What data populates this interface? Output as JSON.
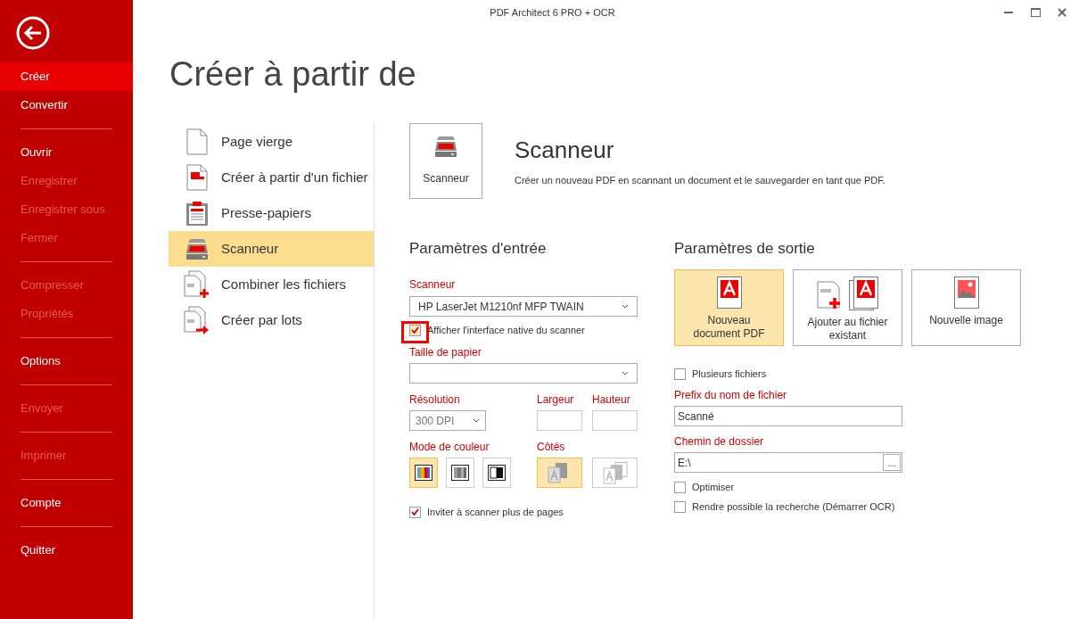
{
  "window": {
    "title": "PDF Architect 6 PRO + OCR"
  },
  "sidebar": {
    "groups": [
      [
        {
          "label": "Créer",
          "selected": true,
          "disabled": false
        },
        {
          "label": "Convertir",
          "selected": false,
          "disabled": false
        }
      ],
      [
        {
          "label": "Ouvrir",
          "selected": false,
          "disabled": false
        },
        {
          "label": "Enregistrer",
          "selected": false,
          "disabled": true
        },
        {
          "label": "Enregistrer sous",
          "selected": false,
          "disabled": true
        },
        {
          "label": "Fermer",
          "selected": false,
          "disabled": true
        }
      ],
      [
        {
          "label": "Compresser",
          "selected": false,
          "disabled": true
        },
        {
          "label": "Propriétés",
          "selected": false,
          "disabled": true
        }
      ],
      [
        {
          "label": "Options",
          "selected": false,
          "disabled": false
        }
      ],
      [
        {
          "label": "Envoyer",
          "selected": false,
          "disabled": true
        }
      ],
      [
        {
          "label": "Imprimer",
          "selected": false,
          "disabled": true
        }
      ],
      [
        {
          "label": "Compte",
          "selected": false,
          "disabled": false
        }
      ],
      [
        {
          "label": "Quitter",
          "selected": false,
          "disabled": false
        }
      ]
    ]
  },
  "page_title": "Créer à partir de",
  "create_options": [
    {
      "label": "Page vierge",
      "kind": "blank",
      "selected": false
    },
    {
      "label": "Créer à partir d'un fichier",
      "kind": "file",
      "selected": false
    },
    {
      "label": "Presse-papiers",
      "kind": "clipboard",
      "selected": false
    },
    {
      "label": "Scanneur",
      "kind": "scanner",
      "selected": true
    },
    {
      "label": "Combiner les fichiers",
      "kind": "combine",
      "selected": false
    },
    {
      "label": "Créer par lots",
      "kind": "batch",
      "selected": false
    }
  ],
  "detail": {
    "tile_label": "Scanneur",
    "title": "Scanneur",
    "description": "Créer un nouveau PDF en scannant un document et le sauvegarder en tant que PDF."
  },
  "input": {
    "heading": "Paramètres d'entrée",
    "scanner_label": "Scanneur",
    "scanner_value": "HP LaserJet M1210nf MFP TWAIN",
    "native_ui": {
      "label": "Afficher l'interface native du scanner",
      "checked": true,
      "highlighted": true
    },
    "paper_label": "Taille de papier",
    "resolution_label": "Résolution",
    "resolution_value": "300 DPI",
    "width_label": "Largeur",
    "height_label": "Hauteur",
    "color_label": "Mode de couleur",
    "color_modes": [
      {
        "kind": "color",
        "selected": true
      },
      {
        "kind": "gray",
        "selected": false
      },
      {
        "kind": "bw",
        "selected": false
      }
    ],
    "sides_label": "Côtés",
    "sides": [
      {
        "kind": "single",
        "selected": true
      },
      {
        "kind": "double",
        "selected": false
      }
    ],
    "more_pages": {
      "label": "Inviter à scanner plus de pages",
      "checked": true
    }
  },
  "output": {
    "heading": "Paramètres de sortie",
    "targets": [
      {
        "kind": "new_pdf",
        "label": "Nouveau document PDF",
        "selected": true
      },
      {
        "kind": "append",
        "label": "Ajouter au fichier existant",
        "selected": false
      },
      {
        "kind": "image",
        "label": "Nouvelle image",
        "selected": false
      }
    ],
    "multiple_files": {
      "label": "Plusieurs fichiers",
      "checked": false
    },
    "prefix_label": "Prefix du nom de fichier",
    "prefix_value": "Scanné",
    "folder_label": "Chemin de dossier",
    "folder_value": "E:\\",
    "browse_label": "...",
    "options": [
      {
        "label": "Optimiser",
        "checked": false
      },
      {
        "label": "Rendre possible la recherche (Démarrer OCR)",
        "checked": false
      }
    ]
  }
}
